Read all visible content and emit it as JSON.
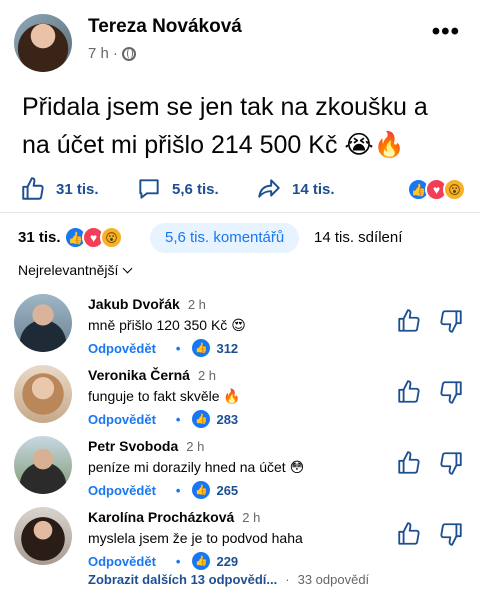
{
  "post": {
    "author": "Tereza Nováková",
    "time": "7 h",
    "text": "Přidala jsem se jen tak na zkoušku a na účet mi přišlo 214 500 Kč 😭🔥"
  },
  "actions": {
    "like_count": "31 tis.",
    "comment_count": "5,6 tis.",
    "share_count": "14 tis."
  },
  "stats": {
    "likes": "31 tis.",
    "comments": "5,6 tis. komentářů",
    "shares": "14 tis. sdílení"
  },
  "sort": {
    "label": "Nejrelevantnější"
  },
  "reply_label": "Odpovědět",
  "comments": [
    {
      "name": "Jakub Dvořák",
      "time": "2 h",
      "text": "mně přišlo 120 350 Kč 😍",
      "likes": "312",
      "avatar_color": "#3b4a5a"
    },
    {
      "name": "Veronika Černá",
      "time": "2 h",
      "text": "funguje to fakt skvěle 🔥",
      "likes": "283",
      "avatar_color": "#c9a37b"
    },
    {
      "name": "Petr Svoboda",
      "time": "2 h",
      "text": "peníze mi dorazily hned na účet 😳",
      "likes": "265",
      "avatar_color": "#6f8a6a"
    },
    {
      "name": "Karolína Procházková",
      "time": "2 h",
      "text": "myslela jsem že je to podvod haha",
      "likes": "229",
      "avatar_color": "#4a3a35"
    }
  ],
  "more_replies": {
    "link": "Zobrazit dalších 13 odpovědí...",
    "count": "33 odpovědí"
  },
  "colors": {
    "accent": "#1877f2",
    "text_blue": "#1d4f91",
    "pill_bg": "#e7f3ff"
  }
}
